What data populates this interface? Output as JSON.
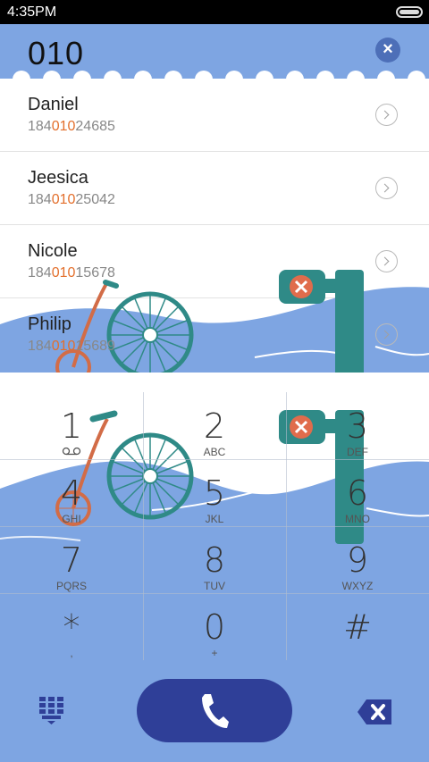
{
  "status": {
    "time": "4:35PM"
  },
  "dialer": {
    "number": "010",
    "clear_symbol": "×"
  },
  "contacts": [
    {
      "name": "Daniel",
      "number_prefix": "184",
      "number_match": "010",
      "number_suffix": "24685"
    },
    {
      "name": "Jeesica",
      "number_prefix": "184",
      "number_match": "010",
      "number_suffix": "25042"
    },
    {
      "name": "Nicole",
      "number_prefix": "184",
      "number_match": "010",
      "number_suffix": "15678"
    },
    {
      "name": "Philip",
      "number_prefix": "184",
      "number_match": "010",
      "number_suffix": "15689"
    }
  ],
  "keypad": {
    "keys": [
      {
        "digit": "1",
        "letters": ""
      },
      {
        "digit": "2",
        "letters": "ABC"
      },
      {
        "digit": "3",
        "letters": "DEF"
      },
      {
        "digit": "4",
        "letters": "GHI"
      },
      {
        "digit": "5",
        "letters": "JKL"
      },
      {
        "digit": "6",
        "letters": "MNO"
      },
      {
        "digit": "7",
        "letters": "PQRS"
      },
      {
        "digit": "8",
        "letters": "TUV"
      },
      {
        "digit": "9",
        "letters": "WXYZ"
      },
      {
        "digit": "*",
        "letters": ","
      },
      {
        "digit": "0",
        "letters": "+"
      },
      {
        "digit": "#",
        "letters": ""
      }
    ]
  },
  "icons": {
    "voicemail": "voicemail-icon",
    "call": "phone-icon",
    "keypad_toggle": "dialpad-icon",
    "backspace": "backspace-icon",
    "contact_detail": "chevron-right-icon"
  },
  "colors": {
    "header_blue": "#7ea5e2",
    "highlight": "#e36f2c",
    "call_button": "#2f3f98"
  }
}
